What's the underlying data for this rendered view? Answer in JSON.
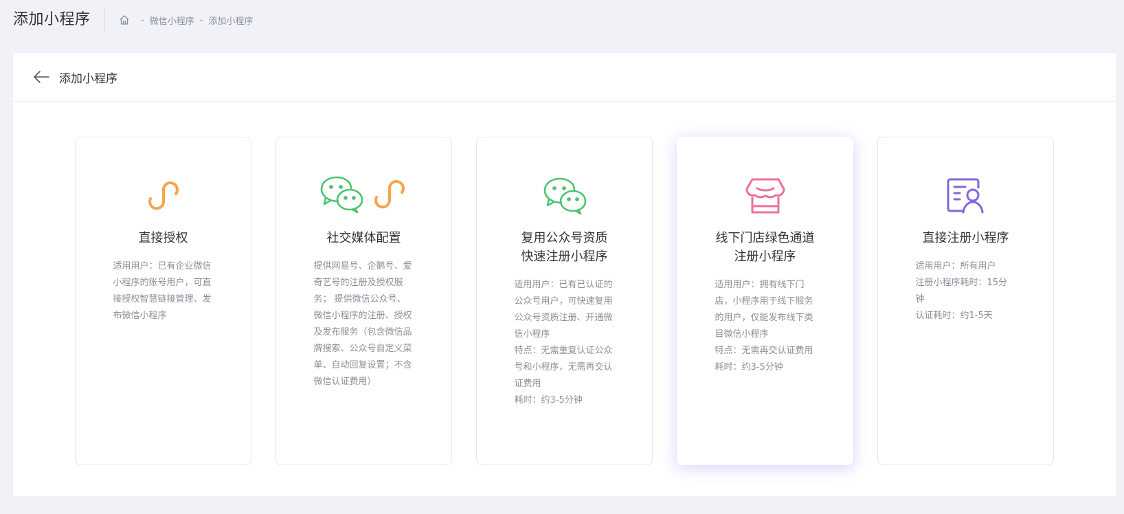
{
  "header": {
    "title": "添加小程序",
    "breadcrumb": [
      "微信小程序",
      "添加小程序"
    ],
    "separator": "-",
    "home_icon": "home-icon"
  },
  "panel": {
    "back_icon": "arrow-left-icon",
    "title": "添加小程序"
  },
  "colors": {
    "orange": "#f5a44f",
    "green": "#4cc46f",
    "pink": "#ee6f9a",
    "purple": "#8066dd",
    "accent_shadow": "#6e5af0"
  },
  "cards": [
    {
      "icon": "miniprogram-icon",
      "title": "直接授权",
      "desc": [
        "适用用户：已有企业微信小程序的账号用户，可直接授权智慧链接管理、发布微信小程序"
      ]
    },
    {
      "icon": "wechat-and-miniprogram-icon",
      "title": "社交媒体配置",
      "desc": [
        "提供网易号、企鹅号、爱奇艺号的注册及授权服务； 提供微信公众号、微信小程序的注册、授权及发布服务（包含微信品牌搜索、公众号自定义菜单、自动回复设置；不含微信认证费用）"
      ]
    },
    {
      "icon": "wechat-icon",
      "title": "复用公众号资质\n快速注册小程序",
      "desc": [
        "适用用户：已有已认证的公众号用户，可快速复用公众号资质注册、开通微信小程序",
        "特点：无需重复认证公众号和小程序，无需再交认证费用",
        "耗时：约3-5分钟"
      ]
    },
    {
      "icon": "store-icon",
      "title": "线下门店绿色通道\n注册小程序",
      "desc": [
        "适用用户：拥有线下门店，小程序用于线下服务的用户，仅能发布线下类目微信小程序",
        "特点：无需再交认证费用",
        "耗时：约3-5分钟"
      ],
      "active": true
    },
    {
      "icon": "user-register-icon",
      "title": "直接注册小程序",
      "desc": [
        "适用用户：所有用户",
        "注册小程序耗时：15分钟",
        "认证耗时：约1-5天"
      ]
    }
  ]
}
